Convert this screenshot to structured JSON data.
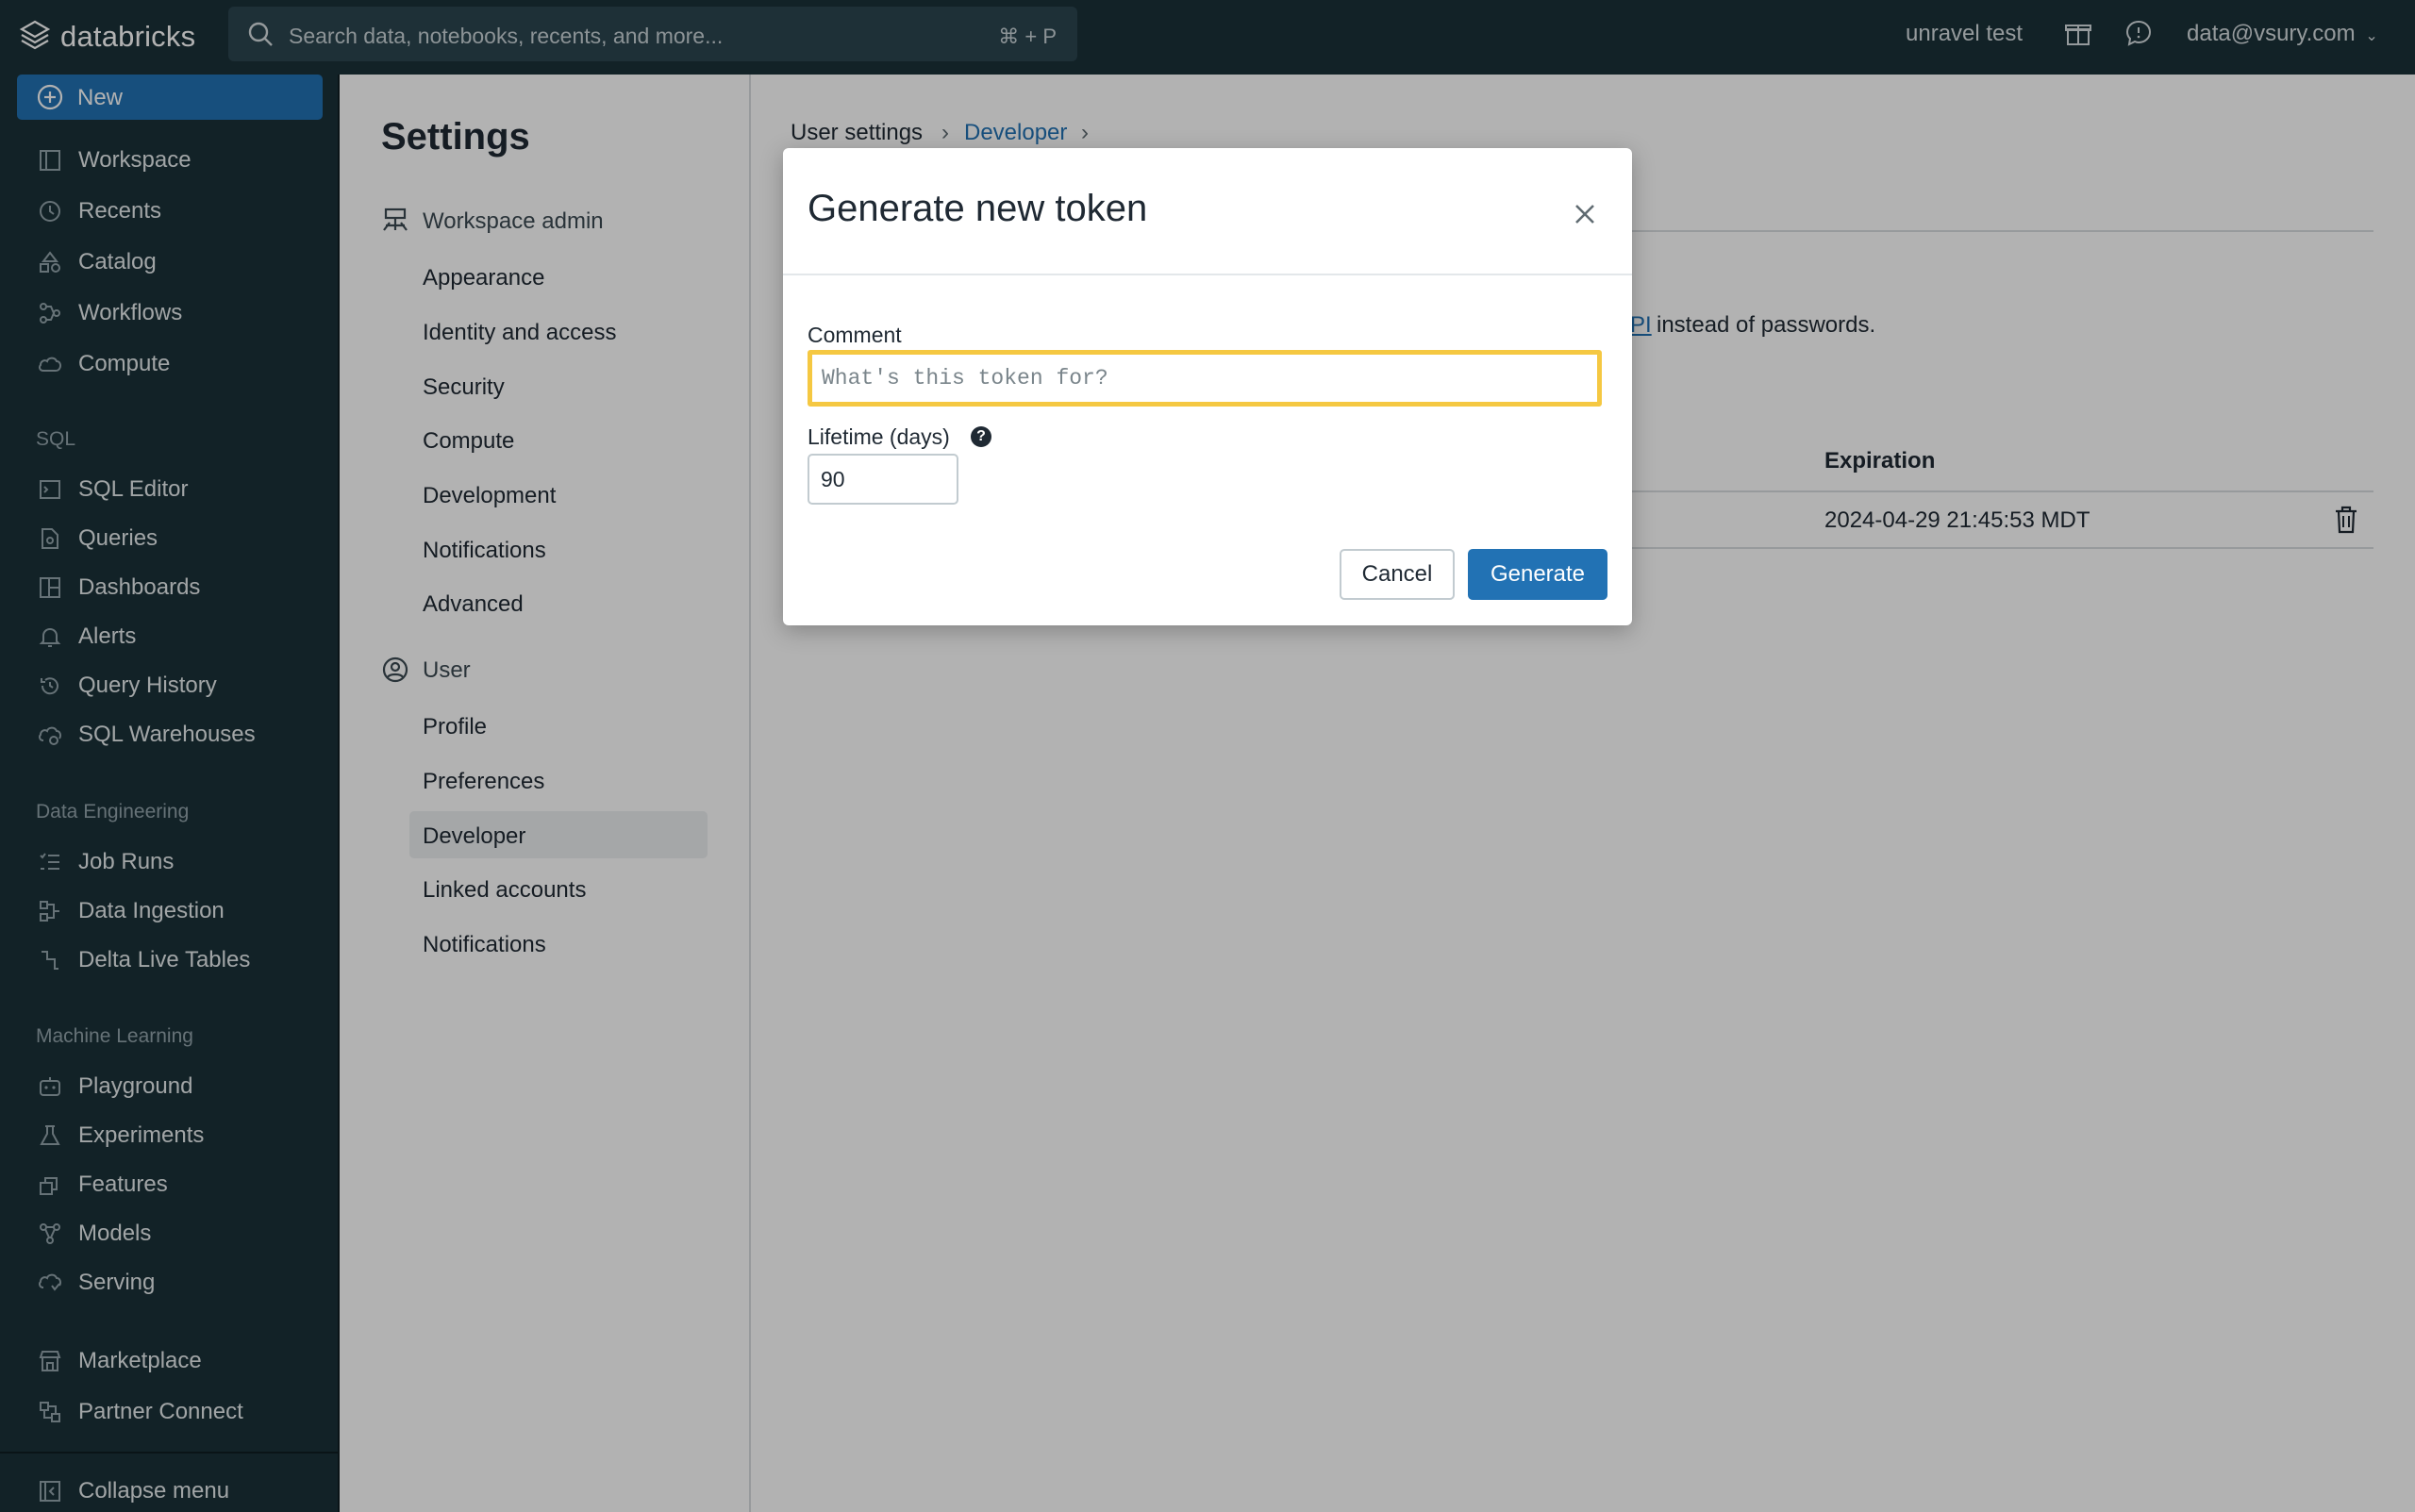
{
  "colors": {
    "accent": "#2272b4",
    "nav_bg": "#1b3139",
    "focus_ring": "#f5c842"
  },
  "topbar": {
    "logo_text": "databricks",
    "search_placeholder": "Search data, notebooks, recents, and more...",
    "search_shortcut": "⌘ + P",
    "workspace_name": "unravel test",
    "user_email": "data@vsury.com"
  },
  "sidebar": {
    "new_label": "New",
    "main_items": [
      "Workspace",
      "Recents",
      "Catalog",
      "Workflows",
      "Compute"
    ],
    "sql_title": "SQL",
    "sql_items": [
      "SQL Editor",
      "Queries",
      "Dashboards",
      "Alerts",
      "Query History",
      "SQL Warehouses"
    ],
    "de_title": "Data Engineering",
    "de_items": [
      "Job Runs",
      "Data Ingestion",
      "Delta Live Tables"
    ],
    "ml_title": "Machine Learning",
    "ml_items": [
      "Playground",
      "Experiments",
      "Features",
      "Models",
      "Serving"
    ],
    "other_items": [
      "Marketplace",
      "Partner Connect"
    ],
    "collapse_label": "Collapse menu"
  },
  "settings": {
    "title": "Settings",
    "workspace_admin_label": "Workspace admin",
    "workspace_admin_items": [
      "Appearance",
      "Identity and access",
      "Security",
      "Compute",
      "Development",
      "Notifications",
      "Advanced"
    ],
    "user_label": "User",
    "user_items": [
      "Profile",
      "Preferences",
      "Developer",
      "Linked accounts",
      "Notifications"
    ],
    "active_item": "Developer"
  },
  "main": {
    "breadcrumb": [
      "User settings",
      "Developer"
    ],
    "description_visible": "instead of passwords.",
    "description_link_fragment": "PI",
    "table": {
      "headers": [
        "Expiration"
      ],
      "rows": [
        {
          "expiration": "2024-04-29 21:45:53 MDT"
        }
      ]
    }
  },
  "modal": {
    "title": "Generate new token",
    "comment_label": "Comment",
    "comment_placeholder": "What's this token for?",
    "comment_value": "",
    "lifetime_label": "Lifetime (days)",
    "lifetime_value": "90",
    "help_glyph": "?",
    "cancel_label": "Cancel",
    "generate_label": "Generate"
  },
  "icons": [
    "databricks-logo-icon",
    "search-icon",
    "gift-icon",
    "feedback-icon",
    "chevron-down-icon",
    "plus-circle-icon",
    "close-icon",
    "trash-icon",
    "help-icon"
  ]
}
